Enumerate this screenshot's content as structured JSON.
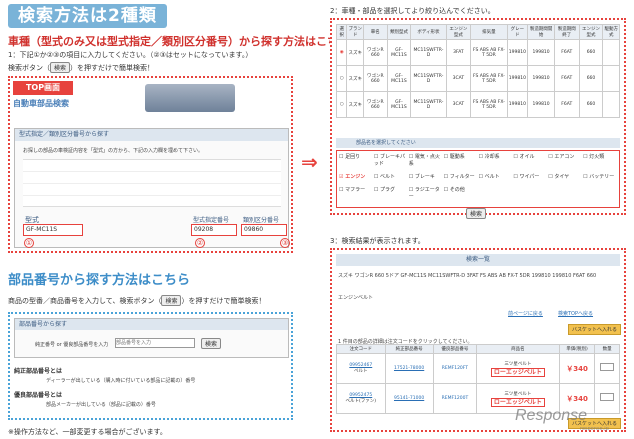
{
  "title": "検索方法は2種類",
  "left": {
    "heading1": "車種（型式のみ又は型式指定／類別区分番号）から探す方法はこちら",
    "step1": "1：下記①か②③の項目に入力してください。（②③はセットになっています。）",
    "step1b_pre": "検索ボタン（",
    "step1b_btn": "検索",
    "step1b_post": "）を押すだけで簡単検索！",
    "top_badge": "TOP画面",
    "top_sub": "自動車部品検索",
    "form_title": "型式指定／類別区分番号から探す",
    "form_note": "お探しの部品の車検証内容を「型式」の方から、下記の入力欄を埋めて下さい。",
    "field1_label": "型式",
    "field1_value": "GF-MC11S",
    "field2_label": "型式指定番号",
    "field2_value": "09208",
    "field3_label": "類別区分番号",
    "field3_value": "09860",
    "nums": [
      "①",
      "②",
      "③"
    ],
    "heading2": "部品番号から探す方法はこちら",
    "step2": "商品の型番／商品番号を入力して、検索ボタン（",
    "step2_btn": "検索",
    "step2_post": "）を押すだけで簡単検索！",
    "part_form_title": "部品番号から探す",
    "part_label": "純正番号 or 優良部品番号を入力",
    "part_placeholder": "部品番号を入力",
    "part_btn": "検索",
    "genuine_title": "純正部品番号とは",
    "genuine_desc": "ディーラーが出している（購入時に付いている部品に記載の）番号",
    "quality_title": "優良部品番号とは",
    "quality_desc": "部品メーカーが出している（部品に記載の）番号",
    "footnote": "※操作方法など、一部変更する場合がございます。"
  },
  "right": {
    "step2": "2：車種・部品を選択してより絞り込んでください。",
    "table_headers": [
      "選択",
      "ブランド",
      "車名",
      "類別型式",
      "ボディ形状",
      "エンジン型式",
      "排気量",
      "グレード",
      "製造期間開始",
      "製造期間終了",
      "エンジン型式",
      "駆動方式",
      "備考"
    ],
    "table_rows": [
      [
        "",
        "スズキ",
        "ワゴンR 660",
        "GF-MC11S",
        "MC11SWFTR-D",
        "3FAT",
        "FS ABS AB FX-T 5DR",
        "199810",
        "199810",
        "F6AT",
        "660"
      ],
      [
        "",
        "スズキ",
        "ワゴンR 660",
        "GF-MC11S",
        "MC11SWFTR-D",
        "3CAT",
        "FS ABS AB FX-T 5DR",
        "199810",
        "199810",
        "F6AT",
        "660"
      ],
      [
        "",
        "スズキ",
        "ワゴンR 660",
        "GF-MC11S",
        "MC11SWFTR-D",
        "3CAT",
        "FS ABS AB FX-T 5DR",
        "199810",
        "199810",
        "F6AT",
        "660"
      ]
    ],
    "parts_title": "部品名を選択してください",
    "parts": [
      "足回り",
      "エンジン",
      "電気・点火系",
      "駆動系",
      "冷却系",
      "オイル",
      "エアコン",
      "灯火類",
      "ブレーキ",
      "フィルター",
      "ベルト",
      "ワイパー",
      "タイヤ",
      "バッテリー",
      "マフラー",
      "その他",
      "ブレーキパッド",
      "ベルト",
      "プラグ",
      "ラジエーター"
    ],
    "search_btn": "検索",
    "step3": "3：検索結果が表示されます。",
    "result_title": "検索一覧",
    "result_car": "スズキ ワゴンR 660 5ドア GF-MC11S MC11SWFTR-D 3FAT FS ABS AB FX-T 5DR 199810 199810 F6AT 660",
    "result_category": "エンジンベルト",
    "nav_prev": "前ページに戻る",
    "nav_top": "検索TOPへ戻る",
    "cart_btn": "バスケットへ入れる",
    "result_note": "1 件目の部品の詳細は注文コードをクリックしてください。",
    "result_headers": [
      "注文コード",
      "純正部品番号",
      "優良部品番号",
      "商品名",
      "単価(税別)",
      "数量"
    ],
    "results": [
      {
        "code": "09952467",
        "genuine": "17521-78000",
        "quality": "REMF120FT",
        "maker": "三ツ星ベルト",
        "name": "ローエッジベルト",
        "price": "￥340",
        "sub": "ベルト"
      },
      {
        "code": "09952475",
        "genuine": "95141-71000",
        "quality": "REMF1200T",
        "maker": "三ツ星ベルト",
        "name": "ローエッジベルト",
        "price": "￥340",
        "sub": "ベルト(ファン)"
      }
    ],
    "watermark": "Response",
    "watermark_url": "response.jp"
  }
}
